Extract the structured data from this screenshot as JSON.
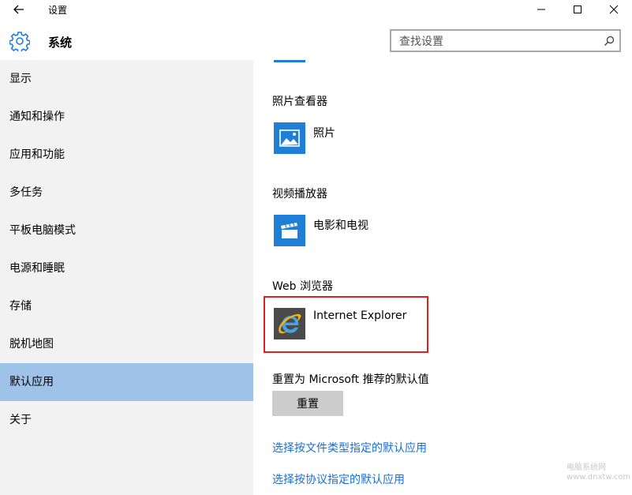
{
  "window": {
    "title": "设置"
  },
  "header": {
    "section_title": "系统",
    "search_placeholder": "查找设置"
  },
  "sidebar": {
    "items": [
      {
        "label": "显示"
      },
      {
        "label": "通知和操作"
      },
      {
        "label": "应用和功能"
      },
      {
        "label": "多任务"
      },
      {
        "label": "平板电脑模式"
      },
      {
        "label": "电源和睡眠"
      },
      {
        "label": "存储"
      },
      {
        "label": "脱机地图"
      },
      {
        "label": "默认应用",
        "selected": true
      },
      {
        "label": "关于"
      }
    ]
  },
  "main": {
    "photo_viewer": {
      "heading": "照片查看器",
      "app_name": "照片",
      "icon": "photos-icon"
    },
    "video_player": {
      "heading": "视频播放器",
      "app_name": "电影和电视",
      "icon": "movies-tv-icon"
    },
    "web_browser": {
      "heading": "Web 浏览器",
      "app_name": "Internet Explorer",
      "icon": "internet-explorer-icon"
    },
    "reset": {
      "label": "重置为 Microsoft 推荐的默认值",
      "button": "重置"
    },
    "links": [
      {
        "label": "选择按文件类型指定的默认应用"
      },
      {
        "label": "选择按协议指定的默认应用"
      }
    ]
  },
  "watermark": {
    "line1": "电脑系统网",
    "line2": "www.dnxtw.com"
  },
  "colors": {
    "accent": "#1f7fd7",
    "sidebar_bg": "#f2f2f2",
    "selected_bg": "#9fc2e8",
    "link": "#1a6fd6",
    "highlight": "#e02020"
  }
}
